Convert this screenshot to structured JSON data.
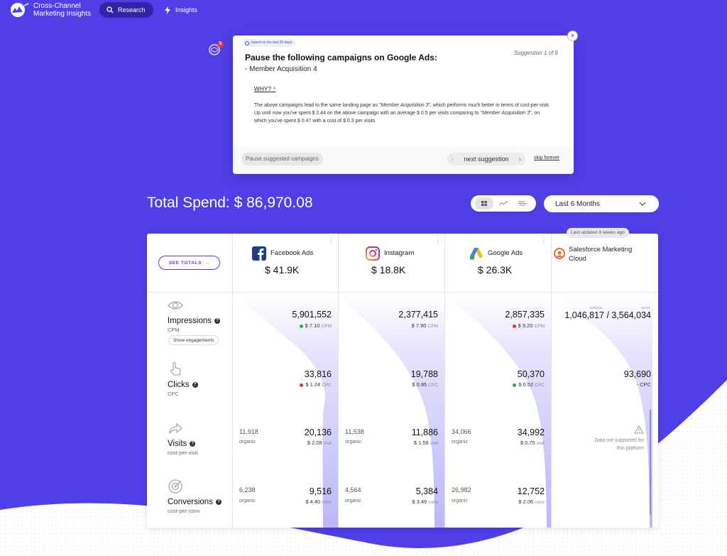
{
  "nav": {
    "brand_line1": "Cross-Channel",
    "brand_line2": "Marketing Insights",
    "research_label": "Research",
    "insights_label": "Insights"
  },
  "notification": {
    "count": "5"
  },
  "suggestion": {
    "badge": "based on the last 30 days",
    "title": "Pause the following campaigns on Google Ads:",
    "campaign": "- Member Acquisition 4",
    "counter": "Suggestion 1 of 6",
    "why_label": "WHY?",
    "why_line1_a": "The above campaigns lead to the same landing page as \"",
    "why_line1_em": "Member Acquisition 3",
    "why_line1_b": "\", which performs much better in terms of cost-per-visit.",
    "why_line2_a": "Up until now you've spent $ 2.44 on the above campaign with an average $ 0.5 per visits comparing to \"",
    "why_line2_em": "Member Acquisition 3",
    "why_line2_b": "\", on which you've spent $ 0.47 with a cost of $ 0.3 per visits",
    "pause_label": "Pause suggested campaigns",
    "next_label": "next suggestion",
    "skip_label": "skip forever",
    "close_symbol": "×"
  },
  "summary": {
    "total_label": "Total Spend:",
    "total_value": "$ 86,970.08",
    "period": "Last 6 Months",
    "updated": "Last updated 8 weeks ago",
    "see_totals": "SEE TOTALS"
  },
  "metrics": {
    "impressions": {
      "title": "Impressions",
      "sub": "CPM",
      "extra": "Show engagements"
    },
    "clicks": {
      "title": "Clicks",
      "sub": "CPC"
    },
    "visits": {
      "title": "Visits",
      "sub": "cost-per-visit."
    },
    "conversions": {
      "title": "Conversions",
      "sub": "cost-per-conv."
    }
  },
  "platforms": {
    "facebook": {
      "name": "Facebook Ads",
      "spend": "$ 41.9K",
      "impressions": "5,901,552",
      "cpm": "$ 7.10",
      "cpm_unit": "CPM",
      "cpm_status": "#21b14b",
      "clicks": "33,816",
      "cpc": "$ 1.24",
      "cpc_unit": "CPC",
      "cpc_status": "#ef2b2b",
      "visits_organic": "11,918",
      "organic_label": "organic",
      "visits": "20,136",
      "cpv": "$ 2.08",
      "cpv_unit": "visit",
      "conv_organic": "6,238",
      "conversions": "9,516",
      "cpconv": "$ 4.40",
      "conv_unit": "conv"
    },
    "instagram": {
      "name": "Instagram",
      "spend": "$ 18.8K",
      "impressions": "2,377,415",
      "cpm": "$ 7.90",
      "cpm_unit": "CPM",
      "clicks": "19,788",
      "cpc": "$ 0.95",
      "cpc_unit": "CPC",
      "visits_organic": "11,538",
      "organic_label": "organic",
      "visits": "11,886",
      "cpv": "$ 1.58",
      "cpv_unit": "visit",
      "conv_organic": "4,564",
      "conversions": "5,384",
      "cpconv": "$ 3.49",
      "conv_unit": "conv"
    },
    "google": {
      "name": "Google Ads",
      "spend": "$ 26.3K",
      "impressions": "2,857,335",
      "cpm": "$ 9.20",
      "cpm_unit": "CPM",
      "cpm_status": "#ef2b2b",
      "clicks": "50,370",
      "cpc": "$ 0.52",
      "cpc_unit": "CPC",
      "cpc_status": "#21b14b",
      "visits_organic": "34,066",
      "organic_label": "organic",
      "visits": "34,992",
      "cpv": "$ 0.75",
      "cpv_unit": "visit",
      "conv_organic": "26,982",
      "conversions": "12,752",
      "cpconv": "$ 2.06",
      "conv_unit": "conv"
    },
    "salesforce": {
      "name_line1": "Salesforce Marketing",
      "name_line2": "Cloud",
      "opens_label": "OPENS",
      "sent_label": "SENT",
      "opens_sent": "1,046,817 / 3,564,034",
      "clicks": "93,690",
      "cpc": "- CPC",
      "na_line1": "Data not supported for",
      "na_line2": "this platform"
    }
  },
  "colors": {
    "background": "#4f3fe8",
    "accent": "#4f3fe8",
    "funnel": "#d7d5fb"
  }
}
